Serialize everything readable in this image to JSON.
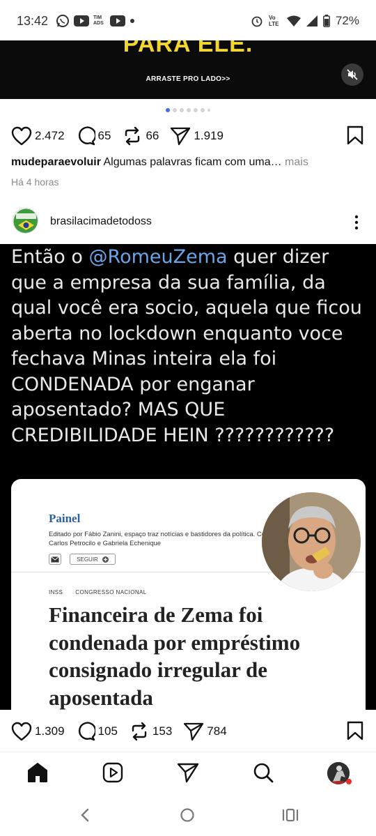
{
  "status_bar": {
    "time": "13:42",
    "left_icons": [
      "whatsapp-icon",
      "youtube-icon",
      "tim-ads-icon",
      "youtube-icon",
      "dot-icon"
    ],
    "tim_ads": "TIM ADS",
    "volte": "Vo LTE",
    "battery": "72%"
  },
  "post1": {
    "media_headline": "PARA ELE.",
    "media_swipe_text": "ARRASTE PRO LADO>>",
    "carousel": {
      "total": 7,
      "active": 1
    },
    "likes": "2.472",
    "comments": "65",
    "reposts": "66",
    "shares": "1.919",
    "username": "mudeparaevoluir",
    "caption": "Algumas palavras ficam com uma…",
    "more_label": "mais",
    "time_ago": "Há 4 horas"
  },
  "post2": {
    "username": "brasilacimadetodoss",
    "tweet_before": "Então o ",
    "tweet_mention": "@RomeuZema",
    "tweet_after": " quer dizer que a empresa da sua família, da qual você era socio, aquela que ficou aberta no lockdown enquanto voce fechava Minas inteira ela foi CONDENADA por enganar aposentado? MAS QUE CREDIBILIDADE HEIN ????????????",
    "news": {
      "section": "Painel",
      "subtitle": "Editado por Fábio Zanini, espaço traz notícias e bastidores da política. Com Carlos Petrocilo e Gabriela Echenique",
      "follow_label": "SEGUIR",
      "tag1": "INSS",
      "tag2": "CONGRESSO NACIONAL",
      "headline": "Financeira de Zema foi condenada por empréstimo consignado irregular de aposentada"
    },
    "likes": "1.309",
    "comments": "105",
    "reposts": "153",
    "shares": "784"
  },
  "bottom_nav": {
    "items": [
      "home-icon",
      "reels-icon",
      "direct-icon",
      "search-icon",
      "profile-avatar"
    ]
  },
  "colors": {
    "accent_blue": "#3f6fe8",
    "mention_blue": "#6aa5e8",
    "headline_yellow": "#f2d630",
    "notification_red": "#ee2a2a"
  }
}
